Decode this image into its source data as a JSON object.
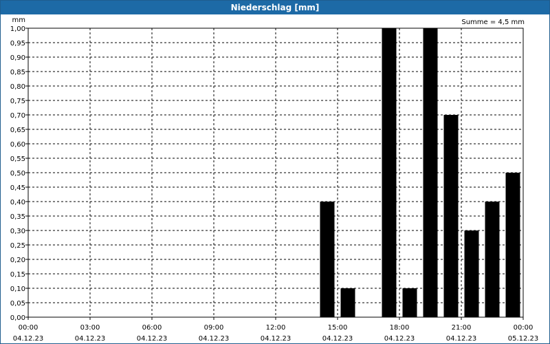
{
  "window": {
    "title": "Niederschlag [mm]"
  },
  "summary_text": "Summe = 4,5 mm",
  "chart_data": {
    "type": "bar",
    "title": "Niederschlag [mm]",
    "ylabel": "mm",
    "xlabel": "",
    "ylim": [
      0,
      1.0
    ],
    "y_ticks": [
      "0,00",
      "0,05",
      "0,10",
      "0,15",
      "0,20",
      "0,25",
      "0,30",
      "0,35",
      "0,40",
      "0,45",
      "0,50",
      "0,55",
      "0,60",
      "0,65",
      "0,70",
      "0,75",
      "0,80",
      "0,85",
      "0,90",
      "0,95",
      "1,00"
    ],
    "x_range_hours": [
      0,
      24
    ],
    "x_ticks": [
      {
        "time": "00:00",
        "date": "04.12.23"
      },
      {
        "time": "03:00",
        "date": "04.12.23"
      },
      {
        "time": "06:00",
        "date": "04.12.23"
      },
      {
        "time": "09:00",
        "date": "04.12.23"
      },
      {
        "time": "12:00",
        "date": "04.12.23"
      },
      {
        "time": "15:00",
        "date": "04.12.23"
      },
      {
        "time": "18:00",
        "date": "04.12.23"
      },
      {
        "time": "21:00",
        "date": "04.12.23"
      },
      {
        "time": "00:00",
        "date": "05.12.23"
      }
    ],
    "bars": [
      {
        "hour": 14,
        "value": 0.4
      },
      {
        "hour": 15,
        "value": 0.1
      },
      {
        "hour": 17,
        "value": 1.0
      },
      {
        "hour": 18,
        "value": 0.1
      },
      {
        "hour": 19,
        "value": 1.0
      },
      {
        "hour": 20,
        "value": 0.7
      },
      {
        "hour": 21,
        "value": 0.3
      },
      {
        "hour": 22,
        "value": 0.4
      },
      {
        "hour": 23,
        "value": 0.5
      }
    ],
    "bar_color": "#000000",
    "grid": true,
    "summary": "Summe = 4,5 mm"
  }
}
